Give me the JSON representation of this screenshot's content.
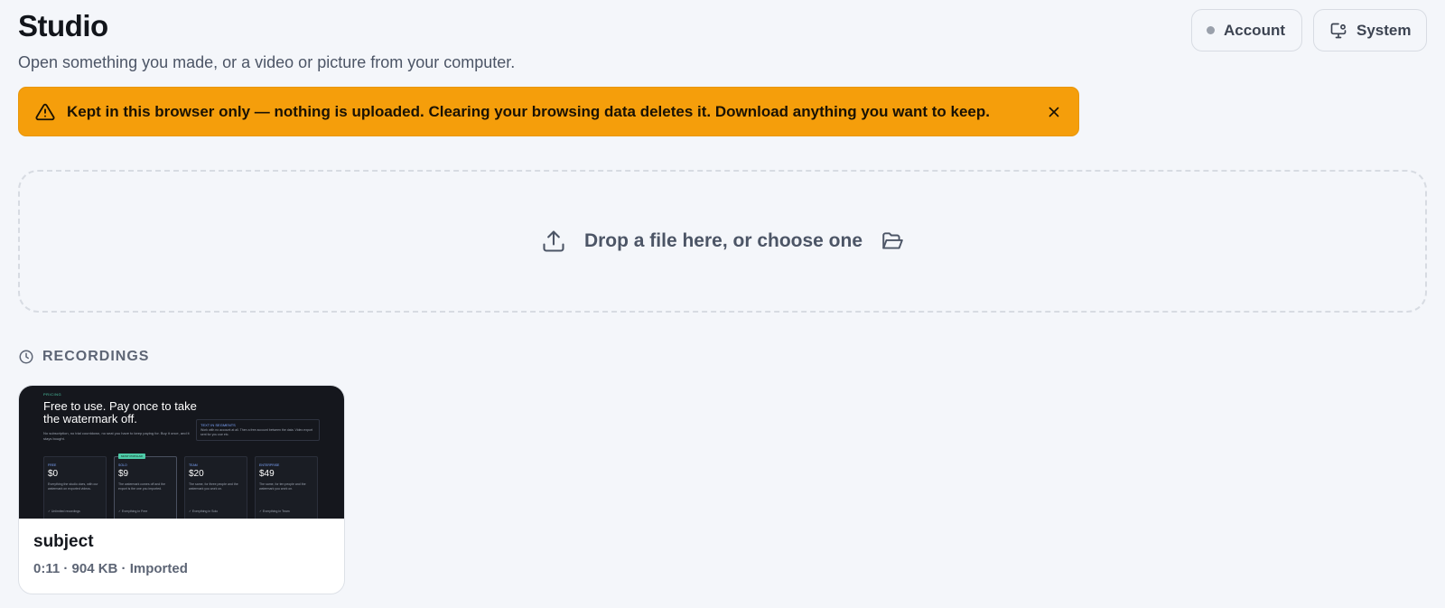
{
  "header": {
    "title": "Studio",
    "subtitle": "Open something you made, or a video or picture from your computer."
  },
  "actions": {
    "account_label": "Account",
    "system_label": "System"
  },
  "banner": {
    "text": "Kept in this browser only — nothing is uploaded. Clearing your browsing data deletes it. Download anything you want to keep.",
    "color": "#f59e0b",
    "icons": [
      "warning-icon",
      "close-icon"
    ]
  },
  "dropzone": {
    "label": "Drop a file here, or choose one",
    "icons": [
      "upload-icon",
      "folder-open-icon"
    ]
  },
  "recordings": {
    "heading": "RECORDINGS",
    "icon": "clock-icon",
    "items": [
      {
        "title": "subject",
        "meta": "0:11 · 904 KB · Imported",
        "thumbnail": {
          "kicker": "PRICING",
          "headline": "Free to use. Pay once to take the watermark off.",
          "sub": "No subscription, no trial countdown, no seat you have to keep paying for. Buy it once, and it stays bought.",
          "box_title": "TEXT IN SEGMENTS",
          "box_text": "Work with no account at all. Then a free account between the data. Video export sent for you use etc.",
          "plans": [
            {
              "name": "FREE",
              "price": "$0",
              "desc": "Everything the studio does, with our watermark on exported videos.",
              "feature": "✓ Unlimited recordings",
              "badge": ""
            },
            {
              "name": "SOLO",
              "price": "$9",
              "desc": "The watermark comes off and the export is the one you imported.",
              "feature": "✓ Everything in Free",
              "badge": "MOST POPULAR"
            },
            {
              "name": "TEAM",
              "price": "$20",
              "desc": "The same, for three people and the watermark you work on.",
              "feature": "✓ Everything in Solo",
              "badge": ""
            },
            {
              "name": "ENTERPRISE",
              "price": "$49",
              "desc": "The same, for ten people and the watermark you work on.",
              "feature": "✓ Everything in Team",
              "badge": ""
            }
          ]
        }
      }
    ]
  }
}
